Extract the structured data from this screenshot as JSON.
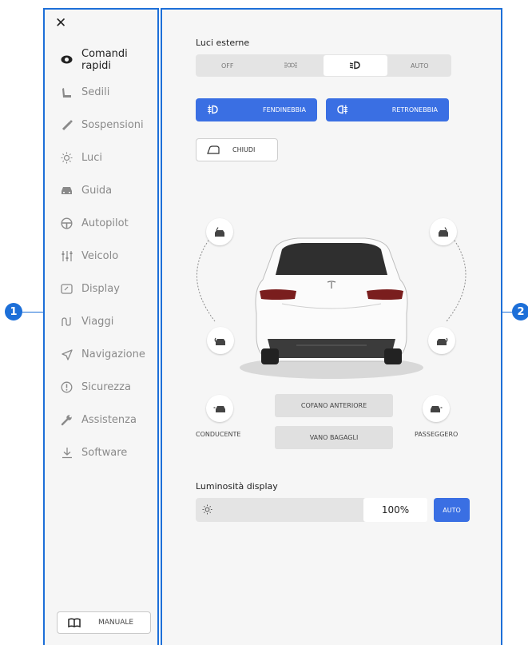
{
  "callouts": {
    "left": "1",
    "right": "2"
  },
  "sidebar": {
    "close_symbol": "✕",
    "items": [
      {
        "label": "Comandi rapidi",
        "icon": "eye-icon",
        "active": true
      },
      {
        "label": "Sedili",
        "icon": "seat-icon"
      },
      {
        "label": "Sospensioni",
        "icon": "suspension-icon"
      },
      {
        "label": "Luci",
        "icon": "light-bulb-icon"
      },
      {
        "label": "Guida",
        "icon": "car-icon"
      },
      {
        "label": "Autopilot",
        "icon": "steering-wheel-icon"
      },
      {
        "label": "Veicolo",
        "icon": "sliders-icon"
      },
      {
        "label": "Display",
        "icon": "display-icon"
      },
      {
        "label": "Viaggi",
        "icon": "trip-icon"
      },
      {
        "label": "Navigazione",
        "icon": "navigation-icon"
      },
      {
        "label": "Sicurezza",
        "icon": "warning-icon"
      },
      {
        "label": "Assistenza",
        "icon": "wrench-icon"
      },
      {
        "label": "Software",
        "icon": "download-icon"
      }
    ],
    "manual_label": "MANUALE"
  },
  "main": {
    "exterior_lights": {
      "label": "Luci esterne",
      "options": [
        "OFF",
        "parking-lights-icon",
        "low-beam-icon",
        "AUTO"
      ],
      "off_label": "OFF",
      "auto_label": "AUTO",
      "selected_index": 2
    },
    "front_fog_label": "FENDINEBBIA",
    "rear_fog_label": "RETRONEBBIA",
    "close_label": "CHIUDI",
    "frunk_label": "COFANO ANTERIORE",
    "trunk_label": "VANO BAGAGLI",
    "driver_label": "CONDUCENTE",
    "passenger_label": "PASSEGGERO",
    "brightness": {
      "label": "Luminosità display",
      "value": "100%",
      "level": 1.0,
      "auto_label": "AUTO"
    }
  },
  "colors": {
    "accent": "#1d6fd8",
    "button_blue": "#3a6fe3",
    "panel_bg": "#f6f6f6"
  }
}
